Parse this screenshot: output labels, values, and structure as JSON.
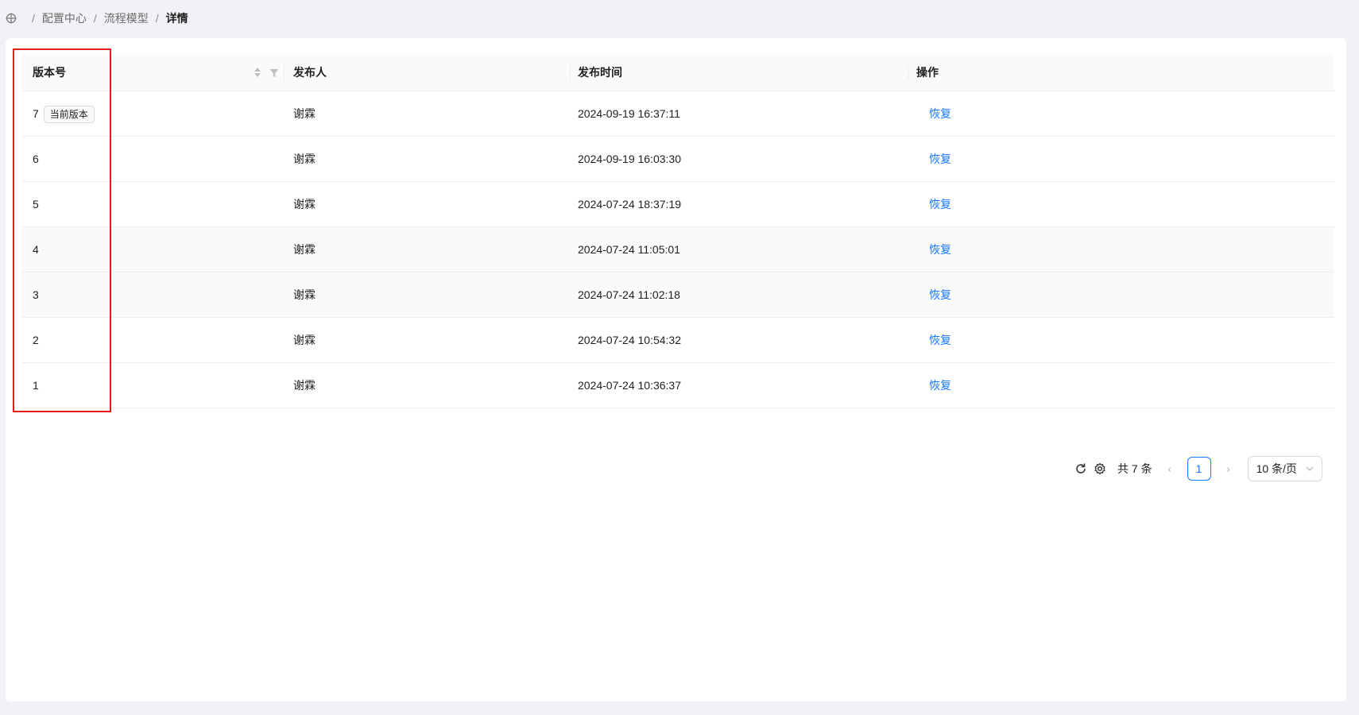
{
  "breadcrumb": {
    "home_icon": "move-icon",
    "items": [
      "配置中心",
      "流程模型",
      "详情"
    ],
    "separator": "/"
  },
  "table": {
    "columns": [
      "版本号",
      "发布人",
      "发布时间",
      "操作"
    ],
    "current_tag": "当前版本",
    "rows": [
      {
        "version": "7",
        "publisher": "谢霖",
        "time": "2024-09-19 16:37:11",
        "action": "恢复"
      },
      {
        "version": "6",
        "publisher": "谢霖",
        "time": "2024-09-19 16:03:30",
        "action": "恢复"
      },
      {
        "version": "5",
        "publisher": "谢霖",
        "time": "2024-07-24 18:37:19",
        "action": "恢复"
      },
      {
        "version": "4",
        "publisher": "谢霖",
        "time": "2024-07-24 11:05:01",
        "action": "恢复"
      },
      {
        "version": "3",
        "publisher": "谢霖",
        "time": "2024-07-24 11:02:18",
        "action": "恢复"
      },
      {
        "version": "2",
        "publisher": "谢霖",
        "time": "2024-07-24 10:54:32",
        "action": "恢复"
      },
      {
        "version": "1",
        "publisher": "谢霖",
        "time": "2024-07-24 10:36:37",
        "action": "恢复"
      }
    ]
  },
  "pagination": {
    "total_text": "共 7 条",
    "current_page": "1",
    "page_size": "10 条/页",
    "prev": "‹",
    "next": "›"
  },
  "colors": {
    "accent": "#1677ff",
    "highlight_border": "#e31c1c"
  }
}
